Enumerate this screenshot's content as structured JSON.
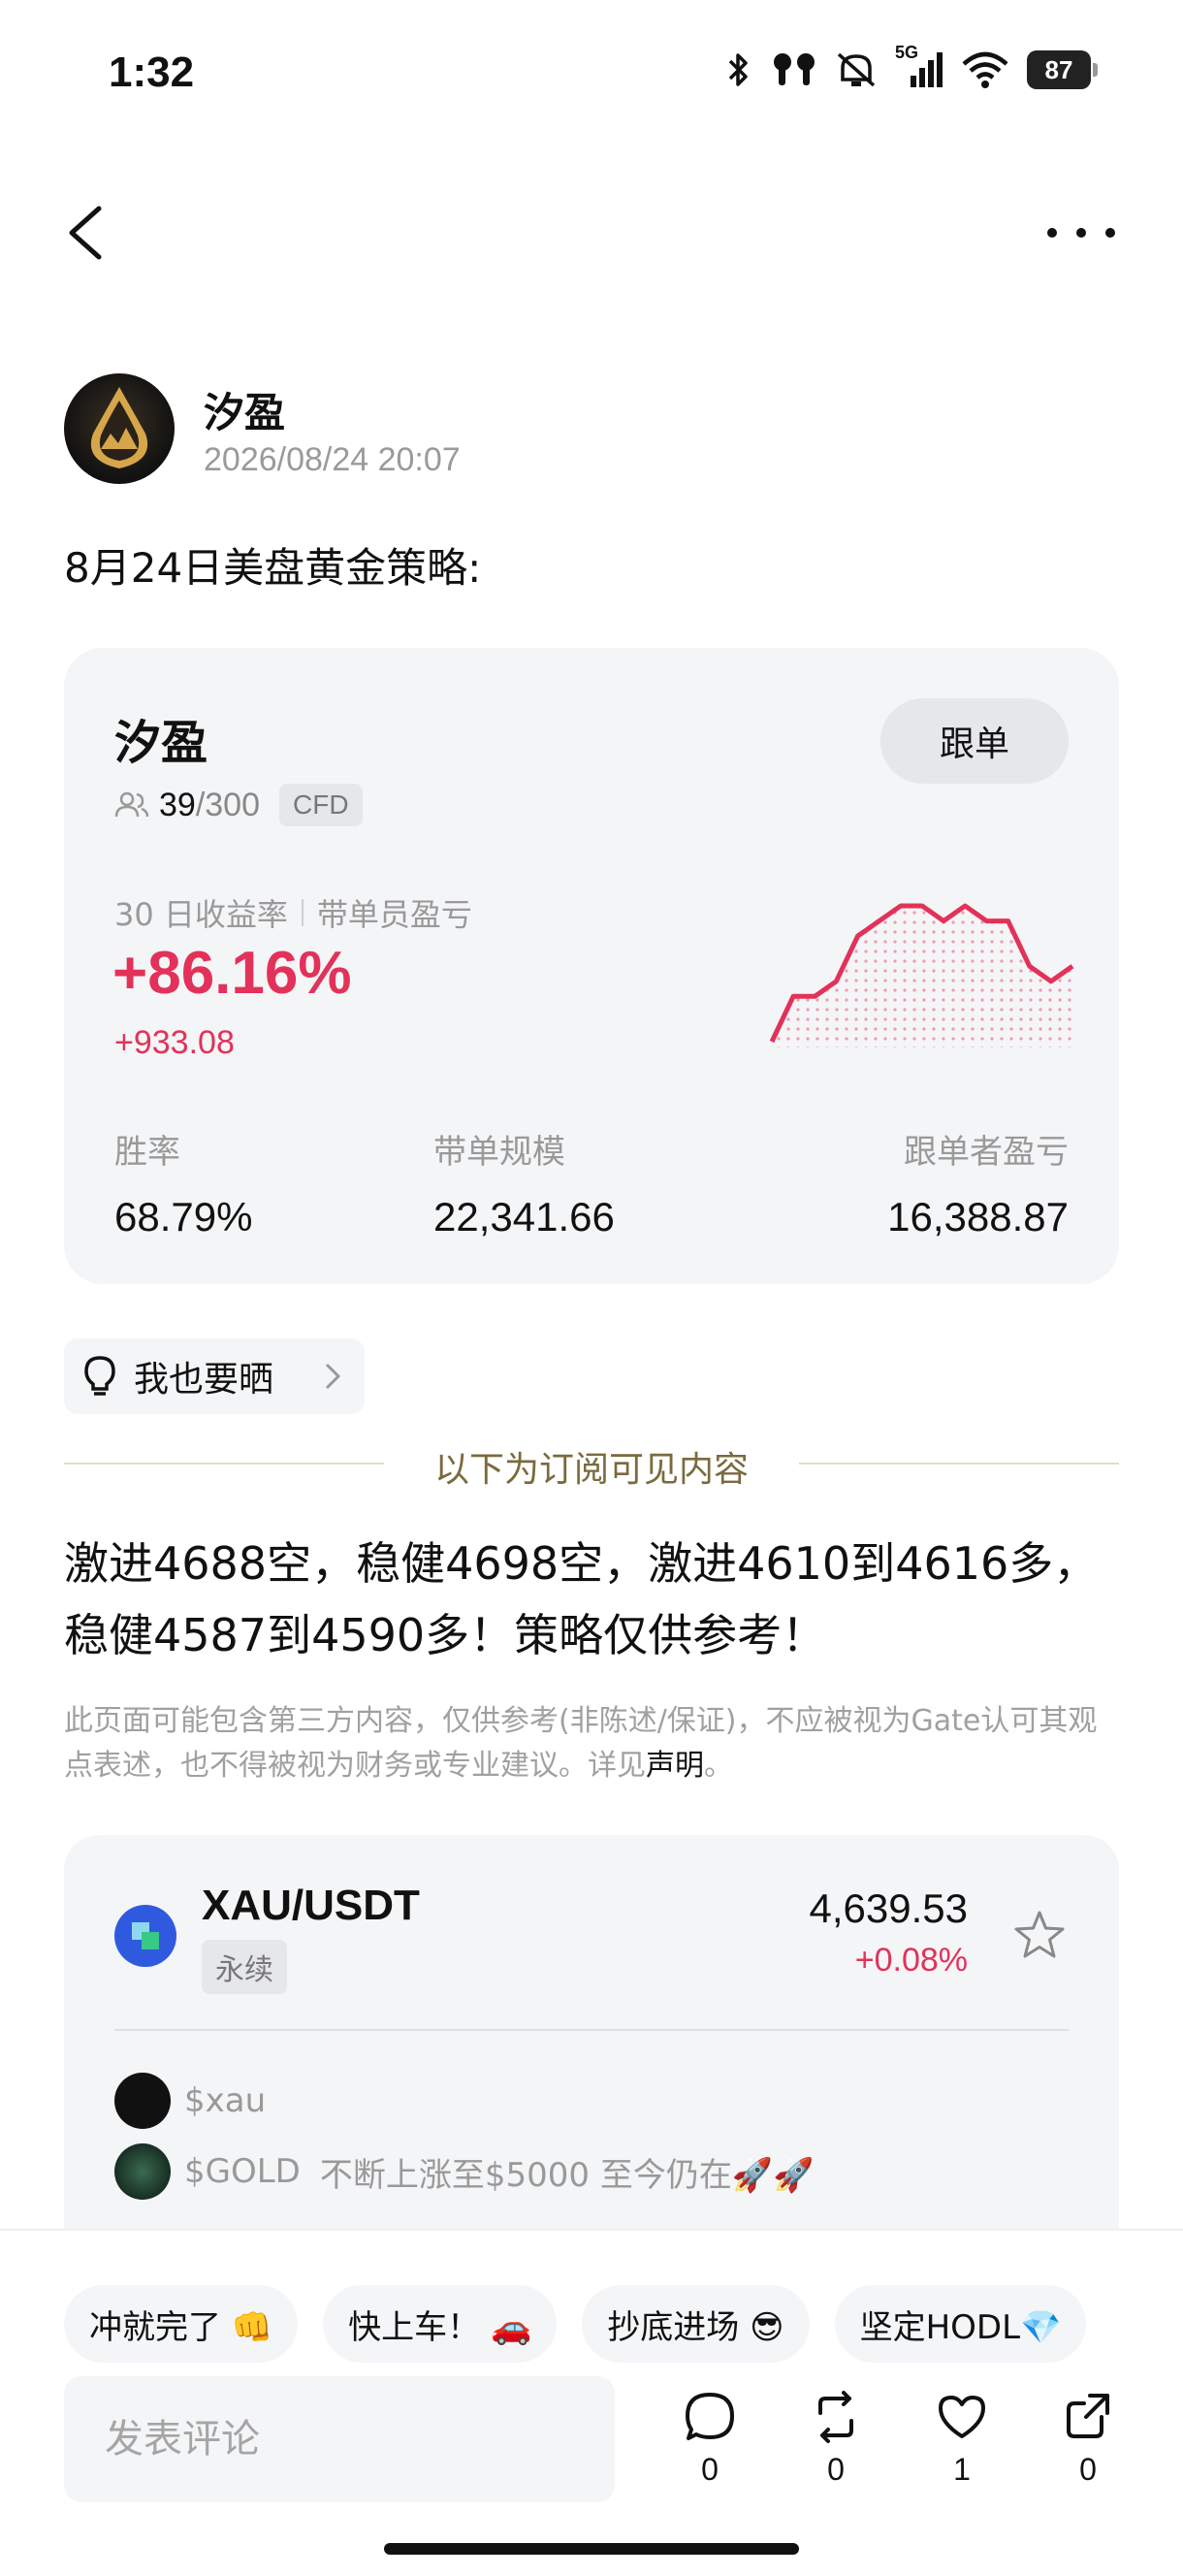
{
  "status_bar": {
    "time": "1:32",
    "network": "5G",
    "battery": "87",
    "icons": [
      "bluetooth-icon",
      "earbuds-icon",
      "mute-icon",
      "signal-icon",
      "wifi-icon",
      "battery-icon"
    ]
  },
  "nav": {
    "back_icon": "chevron-left-icon",
    "more_icon": "more-dots-icon"
  },
  "post": {
    "author": "汐盈",
    "timestamp": "2026/08/24 20:07",
    "title": "8月24日美盘黄金策略:"
  },
  "trader_card": {
    "name": "汐盈",
    "follow_label": "跟单",
    "followers": "39",
    "followers_max": "/300",
    "badge": "CFD",
    "metric_label_1": "30 日收益率",
    "metric_label_2": "带单员盈亏",
    "pnl_percent": "+86.16%",
    "pnl_amount": "+933.08",
    "accent_color": "#e2325a",
    "sparkline": [
      0,
      3,
      3,
      4,
      7,
      8,
      9,
      9,
      8,
      9,
      8,
      8,
      5,
      4,
      5
    ],
    "stats": [
      {
        "label": "胜率",
        "value": "68.79%"
      },
      {
        "label": "带单规模",
        "value": "22,341.66"
      },
      {
        "label": "跟单者盈亏",
        "value": "16,388.87"
      }
    ]
  },
  "share": {
    "label": "我也要晒",
    "icon": "lightbulb-icon"
  },
  "subscriber_divider": "以下为订阅可见内容",
  "strategy_text": "激进4688空，稳健4698空，激进4610到4616多，稳健4587到4590多！策略仅供参考！",
  "disclaimer": {
    "text": "此页面可能包含第三方内容，仅供参考(非陈述/保证)，不应被视为Gate认可其观点表述，也不得被视为财务或专业建议。详见",
    "link": "声明",
    "end": "。"
  },
  "market": {
    "pair": "XAU/USDT",
    "type": "永续",
    "price": "4,639.53",
    "change": "+0.08%",
    "tags": [
      {
        "handle": "$xau",
        "text": ""
      },
      {
        "handle": "$GOLD",
        "text": "不断上涨至$5000 至今仍在🚀🚀"
      }
    ]
  },
  "quick_replies": [
    "冲就完了 👊",
    "快上车！ 🚗",
    "抄底进场 😎",
    "坚定HODL💎"
  ],
  "comment": {
    "placeholder": "发表评论"
  },
  "actions": [
    {
      "name": "comment-icon",
      "count": "0"
    },
    {
      "name": "repost-icon",
      "count": "0"
    },
    {
      "name": "like-icon",
      "count": "1"
    },
    {
      "name": "share-icon",
      "count": "0"
    }
  ]
}
